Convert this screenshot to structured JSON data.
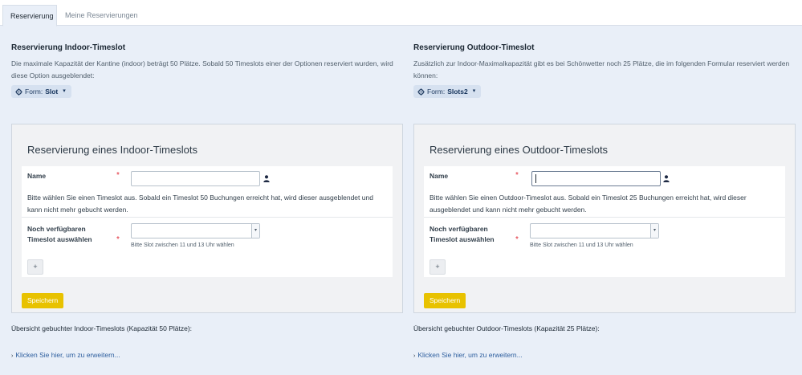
{
  "tabs": [
    {
      "label": "Reservierung",
      "active": true
    },
    {
      "label": "Meine Reservierungen",
      "active": false
    }
  ],
  "indoor": {
    "section_title": "Reservierung Indoor-Timeslot",
    "description": "Die maximale Kapazität der Kantine (indoor) beträgt 50 Plätze. Sobald 50 Timeslots einer der Optionen reserviert wurden, wird diese Option ausgeblendet:",
    "form_prefix": "Form:",
    "form_value": "Slot",
    "panel_title": "Reservierung eines Indoor-Timeslots",
    "name_label": "Name",
    "name_value": "",
    "hint": "Bitte wählen Sie einen Timeslot aus. Sobald ein Timeslot 50 Buchungen erreicht hat, wird dieser ausgeblendet und kann nicht mehr gebucht werden.",
    "slot_label_1": "Noch verfügbaren",
    "slot_label_2": "Timeslot auswählen",
    "slot_selected": "",
    "slot_hint": "Bitte Slot zwischen 11 und 13 Uhr wählen",
    "add_label": "+",
    "save_label": "Speichern",
    "overview_title": "Übersicht gebuchter Indoor-Timeslots (Kapazität 50 Plätze):",
    "expand_label": "Klicken Sie hier, um zu erweitern..."
  },
  "outdoor": {
    "section_title": "Reservierung Outdoor-Timeslot",
    "description": "Zusätzlich zur Indoor-Maximalkapazität gibt es bei Schönwetter noch 25 Plätze, die im folgenden Formular reserviert werden können:",
    "form_prefix": "Form:",
    "form_value": "Slots2",
    "panel_title": "Reservierung eines Outdoor-Timeslots",
    "name_label": "Name",
    "name_value": "",
    "hint": "Bitte wählen Sie einen Outdoor-Timeslot aus. Sobald ein Timeslot 25 Buchungen erreicht hat, wird dieser ausgeblendet und kann nicht mehr gebucht werden.",
    "slot_label_1": "Noch verfügbaren",
    "slot_label_2": "Timeslot auswählen",
    "slot_selected": "",
    "slot_hint": "Bitte Slot zwischen 11 und 13 Uhr wählen",
    "add_label": "+",
    "save_label": "Speichern",
    "overview_title": "Übersicht gebuchter Outdoor-Timeslots (Kapazität 25 Plätze):",
    "expand_label": "Klicken Sie hier, um zu erweitern..."
  },
  "required_mark": "*",
  "icons": {
    "form": "gear-icon",
    "dropdown": "chevron-down-icon",
    "user": "user-icon",
    "expand": "chevron-right-icon"
  },
  "colors": {
    "accent_button": "#e8c200",
    "required": "#e12d39",
    "link": "#2d5e9e",
    "background": "#e9eff8"
  }
}
